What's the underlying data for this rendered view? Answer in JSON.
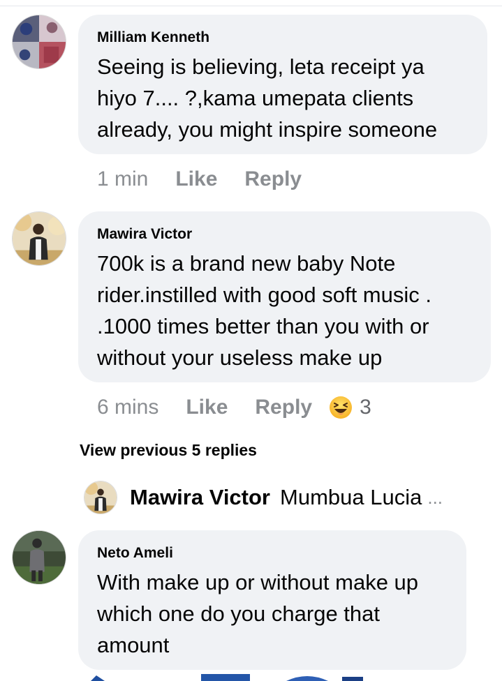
{
  "comments": [
    {
      "author": "Milliam Kenneth",
      "text": "Seeing is believing, leta receipt ya\nhiyo 7.... ?,kama umepata clients\nalready, you might inspire someone",
      "time": "1 min",
      "like_label": "Like",
      "reply_label": "Reply"
    },
    {
      "author": "Mawira Victor",
      "text": "700k is a brand new baby Note\nrider.instilled with good soft music .\n.1000 times better than you with or\nwithout your useless make up",
      "time": "6 mins",
      "like_label": "Like",
      "reply_label": "Reply",
      "reaction": {
        "icon": "laughing-emoji-icon",
        "count": "3"
      }
    },
    {
      "author": "Neto Ameli",
      "text": "With make up or without make up\nwhich one do you charge that\namount"
    }
  ],
  "view_previous": "View previous 5 replies",
  "reply_preview": {
    "author": "Mawira Victor",
    "text": "Mumbua Lucia",
    "ellipsis": "..."
  },
  "colors": {
    "bubble": "#f0f2f5",
    "meta_text": "#8a8d91",
    "primary_text": "#050505"
  }
}
